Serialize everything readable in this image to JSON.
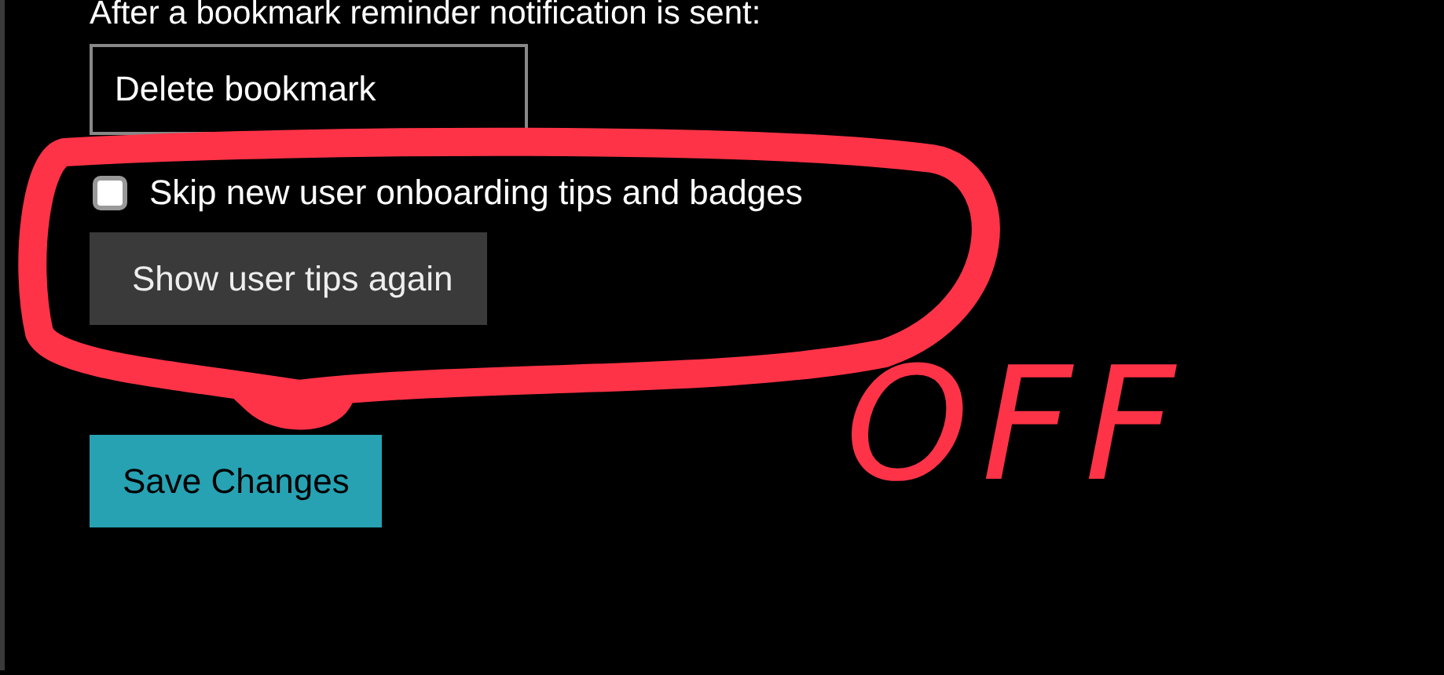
{
  "settings": {
    "reminder_label": "After a bookmark reminder notification is sent:",
    "reminder_action": {
      "value": "Delete bookmark"
    },
    "skip_tips": {
      "label": "Skip new user onboarding tips and badges",
      "checked": false
    },
    "show_tips_button": "Show user tips again",
    "save_button": "Save Changes"
  },
  "annotation": {
    "note": "OFF",
    "color": "#ff3347"
  }
}
